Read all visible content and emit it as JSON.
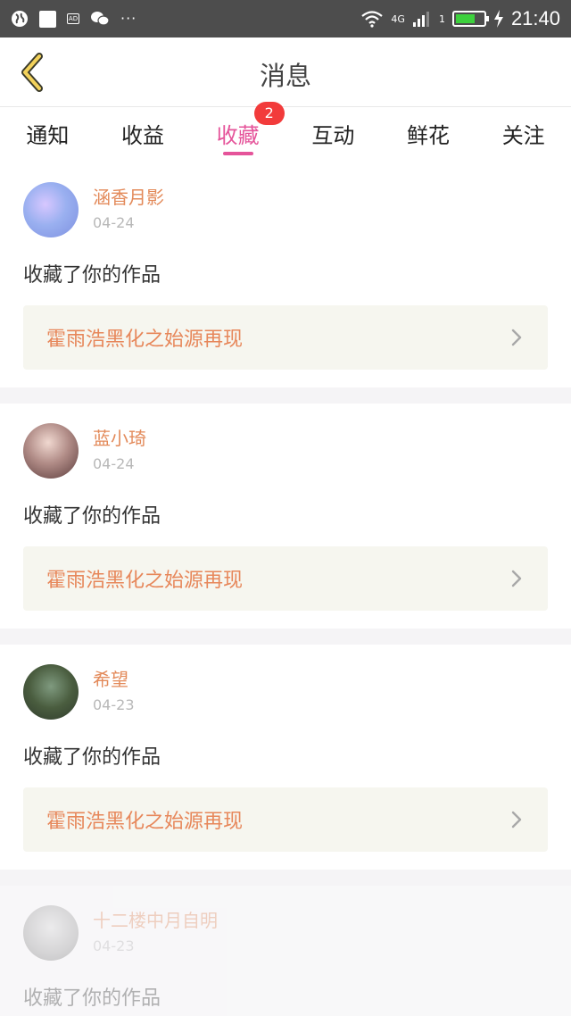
{
  "header": {
    "title": "消息"
  },
  "statusbar": {
    "network": "4G",
    "signal_sub": "1",
    "time": "21:40",
    "more": "···"
  },
  "tabs": [
    {
      "label": "通知"
    },
    {
      "label": "收益"
    },
    {
      "label": "收藏",
      "badge": "2",
      "active": true
    },
    {
      "label": "互动"
    },
    {
      "label": "鲜花"
    },
    {
      "label": "关注"
    }
  ],
  "items": [
    {
      "username": "涵香月影",
      "date": "04-24",
      "action": "收藏了你的作品",
      "work": "霍雨浩黑化之始源再现"
    },
    {
      "username": "蓝小琦",
      "date": "04-24",
      "action": "收藏了你的作品",
      "work": "霍雨浩黑化之始源再现"
    },
    {
      "username": "希望",
      "date": "04-23",
      "action": "收藏了你的作品",
      "work": "霍雨浩黑化之始源再现"
    },
    {
      "username": "十二楼中月自明",
      "date": "04-23",
      "action": "收藏了你的作品"
    }
  ],
  "colors": {
    "accent": "#e5549a",
    "username": "#e38a5a",
    "work_title": "#e7875a",
    "badge": "#f23b3b"
  }
}
